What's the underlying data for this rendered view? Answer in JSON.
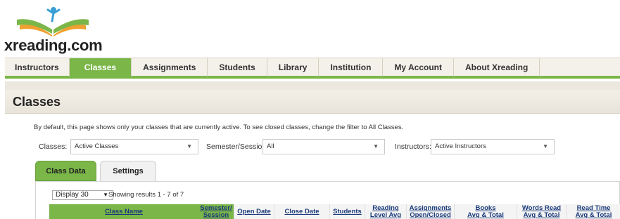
{
  "brand": {
    "name": "xreading.com"
  },
  "nav": {
    "items": [
      {
        "label": "Instructors"
      },
      {
        "label": "Classes"
      },
      {
        "label": "Assignments"
      },
      {
        "label": "Students"
      },
      {
        "label": "Library"
      },
      {
        "label": "Institution"
      },
      {
        "label": "My Account"
      },
      {
        "label": "About Xreading"
      }
    ],
    "active": "Classes"
  },
  "page": {
    "title": "Classes",
    "intro": "By default, this page shows only your classes that are currently active. To see closed classes, change the filter to All Classes."
  },
  "filters": {
    "classes": {
      "label": "Classes:",
      "value": "Active Classes"
    },
    "semester": {
      "label": "Semester/Session:",
      "value": "All"
    },
    "instructors": {
      "label": "Instructors:",
      "value": "Active Instructors"
    }
  },
  "tabs": {
    "class_data": "Class Data",
    "settings": "Settings"
  },
  "table": {
    "display_value": "Display 30",
    "results_text": "Showing results 1 - 7 of 7",
    "columns": {
      "class_name": "Class Name",
      "semester_1": "Semester/",
      "semester_2": "Session",
      "open_date": "Open Date",
      "close_date": "Close Date",
      "students": "Students",
      "reading_1": "Reading",
      "reading_2": "Level Avg",
      "assign_1": "Assignments",
      "assign_2": "Open/Closed",
      "books_1": "Books",
      "books_2": "Avg & Total",
      "words_1": "Words Read",
      "words_2": "Avg & Total",
      "time_1": "Read Time",
      "time_2": "Avg & Total"
    }
  },
  "colors": {
    "accent_green": "#7ab648",
    "link_blue": "#1a3a7a",
    "nav_bg": "#f4f1ea"
  }
}
